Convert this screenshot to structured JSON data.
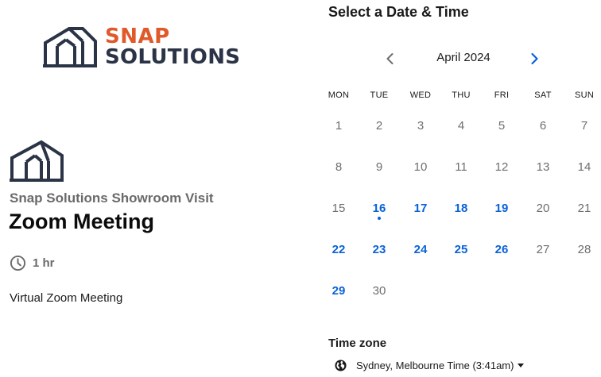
{
  "brand": {
    "line1": "SNAP",
    "line2": "SOLUTIONS",
    "accent_color": "#e0592a",
    "dark_color": "#2b3446"
  },
  "event": {
    "host": "Snap Solutions Showroom Visit",
    "title": "Zoom Meeting",
    "duration": "1 hr",
    "location": "Virtual Zoom Meeting"
  },
  "calendar": {
    "heading": "Select a Date & Time",
    "month": "April 2024",
    "weekdays": [
      "MON",
      "TUE",
      "WED",
      "THU",
      "FRI",
      "SAT",
      "SUN"
    ],
    "first_weekday_index": 0,
    "days": [
      {
        "label": "1",
        "available": false
      },
      {
        "label": "2",
        "available": false
      },
      {
        "label": "3",
        "available": false
      },
      {
        "label": "4",
        "available": false
      },
      {
        "label": "5",
        "available": false
      },
      {
        "label": "6",
        "available": false
      },
      {
        "label": "7",
        "available": false
      },
      {
        "label": "8",
        "available": false
      },
      {
        "label": "9",
        "available": false
      },
      {
        "label": "10",
        "available": false
      },
      {
        "label": "11",
        "available": false
      },
      {
        "label": "12",
        "available": false
      },
      {
        "label": "13",
        "available": false
      },
      {
        "label": "14",
        "available": false
      },
      {
        "label": "15",
        "available": false
      },
      {
        "label": "16",
        "available": true,
        "today": true
      },
      {
        "label": "17",
        "available": true
      },
      {
        "label": "18",
        "available": true
      },
      {
        "label": "19",
        "available": true
      },
      {
        "label": "20",
        "available": false
      },
      {
        "label": "21",
        "available": false
      },
      {
        "label": "22",
        "available": true
      },
      {
        "label": "23",
        "available": true
      },
      {
        "label": "24",
        "available": true
      },
      {
        "label": "25",
        "available": true
      },
      {
        "label": "26",
        "available": true
      },
      {
        "label": "27",
        "available": false
      },
      {
        "label": "28",
        "available": false
      },
      {
        "label": "29",
        "available": true
      },
      {
        "label": "30",
        "available": false
      }
    ],
    "available_color": "#0a62d8",
    "unavailable_color": "#6e6e6e"
  },
  "timezone": {
    "label": "Time zone",
    "value": "Sydney, Melbourne Time (3:41am)"
  },
  "icons": {
    "brand": "house-outline-icon",
    "event": "house-outline-icon",
    "duration": "clock-icon",
    "prev": "chevron-left-icon",
    "next": "chevron-right-icon",
    "timezone": "globe-icon",
    "dropdown": "caret-down-icon"
  }
}
